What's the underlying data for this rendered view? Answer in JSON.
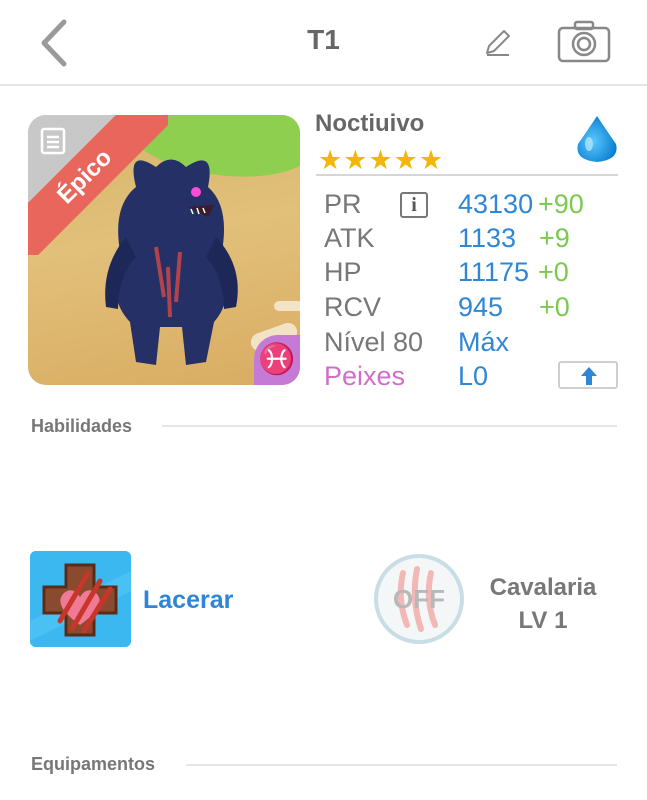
{
  "header": {
    "title": "T1",
    "back_icon": "chevron-left-icon",
    "edit_icon": "pencil-icon",
    "camera_icon": "camera-icon"
  },
  "monster": {
    "rarity": "Épico",
    "name": "Noctiuivo",
    "stars": "★★★★★",
    "star_count": 5,
    "element": "water",
    "zodiac_symbol": "♓",
    "stats": {
      "pr": {
        "label": "PR",
        "value": "43130",
        "bonus": "+90"
      },
      "atk": {
        "label": "ATK",
        "value": "1133",
        "bonus": "+9"
      },
      "hp": {
        "label": "HP",
        "value": "11175",
        "bonus": "+0"
      },
      "rcv": {
        "label": "RCV",
        "value": "945",
        "bonus": "+0"
      },
      "level": {
        "label": "Nível 80",
        "value": "Máx"
      },
      "fish": {
        "label": "Peixes",
        "value": "L0"
      }
    },
    "info_button": "i"
  },
  "sections": {
    "skills_title": "Habilidades",
    "equipment_title": "Equipamentos"
  },
  "skills": {
    "active": {
      "name": "Lacerar",
      "icon": "claw-cross-icon"
    },
    "passive": {
      "status": "OFF",
      "name_line1": "Cavalaria",
      "name_line2": "LV 1",
      "icon": "claw-marks-icon"
    }
  },
  "colors": {
    "accent_blue": "#2f86d6",
    "bonus_green": "#7bc94f",
    "rarity_red": "#e8665c",
    "fish_pink": "#cf6fc9",
    "star_gold": "#f2b705"
  }
}
